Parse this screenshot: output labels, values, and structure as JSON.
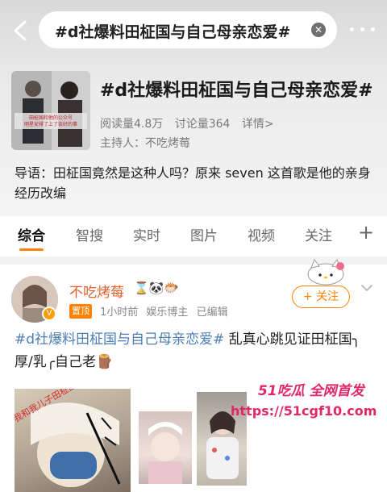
{
  "search": {
    "query": "#d社爆料田柾国与自己母亲恋爱#",
    "clear_icon": "close-icon"
  },
  "topic": {
    "title": "#d社爆料田柾国与自己母亲恋爱#",
    "reads": "阅读量4.8万",
    "discussions": "讨论量364",
    "details": "详情>",
    "host": "主持人：不吃烤莓",
    "intro": "导语：田柾国竟然是这种人吗？原来 seven 这首歌是他的亲身经历改编",
    "cover_caption": "田柾国和他的公众号 明星安排了上了谈好的事"
  },
  "tabs": [
    "综合",
    "智搜",
    "实时",
    "图片",
    "视频",
    "关注"
  ],
  "active_tab": "综合",
  "post": {
    "author": "不吃烤莓",
    "emojis": "⌛🐼🐡",
    "pinned": "置顶",
    "time": "1小时前",
    "role": "娱乐博主",
    "edited": "已编辑",
    "follow_label": "+ 关注",
    "tag": "#d社爆料田柾国与自己母亲恋爱#",
    "text": " 乱真心跳见证田柾国╮厚/乳╭自己老🪵",
    "image_caption": "我和我儿子田柾国"
  },
  "watermark": {
    "brand": "51吃瓜 全网首发",
    "url": "https://51cgf10.com"
  },
  "colors": {
    "accent": "#ff8200",
    "link": "#4d7eb3",
    "author": "#e4602b",
    "watermark": "#e02869"
  }
}
